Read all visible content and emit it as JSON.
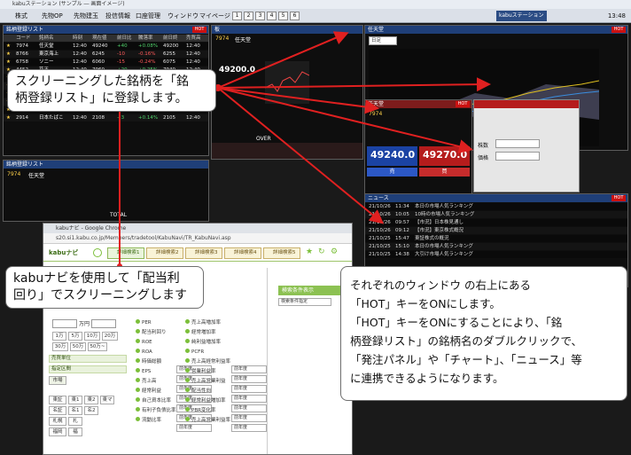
{
  "app": {
    "title": "kabuステーション (サンプル ― 画面イメージ)",
    "menu": [
      "株式",
      "先物OP",
      "先物建玉",
      "投信情報",
      "口座管理",
      "ウィンドウ",
      "マイページ"
    ],
    "layout_numbers": [
      "1",
      "2",
      "3",
      "4",
      "5",
      "6"
    ],
    "logo": "kabuステーション",
    "clock": "13:48",
    "accent_red": "#cc1111",
    "accent_blue": "#1f3f78"
  },
  "list_panel": {
    "title": "銘柄登録リスト",
    "hot_label": "HOT",
    "columns": [
      "コード",
      "銘柄名",
      "時刻",
      "現在値",
      "前日比",
      "騰落率",
      "前日終",
      "売買高"
    ],
    "rows": [
      {
        "code": "7974",
        "name": "任天堂",
        "time": "12:40",
        "price": "49240",
        "chg": "+40",
        "pct": "+0.08%",
        "prev": "49200",
        "vol": "12:40"
      },
      {
        "code": "8766",
        "name": "東京海上",
        "time": "12:40",
        "price": "6245",
        "chg": "-10",
        "pct": "-0.16%",
        "prev": "6255",
        "vol": "12:40"
      },
      {
        "code": "6758",
        "name": "ソニー",
        "time": "12:40",
        "price": "6060",
        "chg": "-15",
        "pct": "-0.24%",
        "prev": "6075",
        "vol": "12:40"
      },
      {
        "code": "4452",
        "name": "花王",
        "time": "12:40",
        "price": "7960",
        "chg": "+20",
        "pct": "+0.25%",
        "prev": "7940",
        "vol": "12:40"
      },
      {
        "code": "3659",
        "name": "ネクソン",
        "time": "12:40",
        "price": "2670",
        "chg": "+5",
        "pct": "+0.19%",
        "prev": "2665",
        "vol": "12:40"
      },
      {
        "code": "4755",
        "name": "ディスコ",
        "time": "12:40",
        "price": "31150",
        "chg": "-150",
        "pct": "-0.48%",
        "prev": "31300",
        "vol": "12:40"
      },
      {
        "code": "4704",
        "name": "トレンド",
        "time": "12:40",
        "price": "6480",
        "chg": "-10",
        "pct": "-0.15%",
        "prev": "6490",
        "vol": "12:40"
      },
      {
        "code": "1925",
        "name": "大和ハウス",
        "time": "12:40",
        "price": "3190",
        "chg": "+15",
        "pct": "+0.47%",
        "prev": "3175",
        "vol": "12:40"
      },
      {
        "code": "4021",
        "name": "日産化",
        "time": "12:40",
        "price": "5960",
        "chg": "+30",
        "pct": "+0.51%",
        "prev": "5930",
        "vol": "12:40"
      },
      {
        "code": "2914",
        "name": "日本たばこ",
        "time": "12:40",
        "price": "2108",
        "chg": "+3",
        "pct": "+0.14%",
        "prev": "2105",
        "vol": "12:40"
      }
    ]
  },
  "board_panel": {
    "title": "板",
    "code": "7974",
    "name": "任天堂",
    "price": "49240.0",
    "sub_price": "49200.0",
    "over": "OVER",
    "under": "UNDER",
    "ask": [
      "49290",
      "49280",
      "49270",
      "49260",
      "49250"
    ],
    "bid": [
      "49240",
      "49230",
      "49220",
      "49210",
      "49200"
    ]
  },
  "chart_panel": {
    "title": "チャート",
    "name": "任天堂",
    "period": "日足",
    "hot_label": "HOT"
  },
  "order_panel": {
    "title": "発注パネル",
    "code": "7974",
    "name": "任天堂",
    "sell_price": "49240.0",
    "buy_price": "49270.0",
    "sell_label": "売",
    "buy_label": "買",
    "hot_label": "HOT",
    "qty_label": "株数",
    "price_label": "価格"
  },
  "news_panel": {
    "title": "ニュース",
    "hot_label": "HOT",
    "items": [
      {
        "date": "21/10/26",
        "time": "11:34",
        "text": "本日の市場人気ランキング"
      },
      {
        "date": "21/10/26",
        "time": "10:05",
        "text": "10時の市場人気ランキング"
      },
      {
        "date": "21/10/26",
        "time": "09:57",
        "text": "【市況】日本株見通し"
      },
      {
        "date": "21/10/26",
        "time": "09:12",
        "text": "【市況】東京株式概況"
      },
      {
        "date": "21/10/25",
        "time": "15:47",
        "text": "東証株式の概況"
      },
      {
        "date": "21/10/25",
        "time": "15:10",
        "text": "本日の市場人気ランキング"
      },
      {
        "date": "21/10/25",
        "time": "14:38",
        "text": "大引け市場人気ランキング"
      }
    ]
  },
  "bottom_left_panel": {
    "title": "銘柄登録リスト",
    "code": "7974",
    "name": "任天堂",
    "total_label": "TOTAL"
  },
  "browser": {
    "title": "kabuナビ - Google Chrome",
    "url": "s20.si1.kabu.co.jp/Members/tradetool/KabuNavi/TR_KabuNavi.asp",
    "brand": "kabuナビ",
    "tabs": [
      "詳細検索1",
      "詳細検索2",
      "詳細検索3",
      "詳細検索4",
      "詳細検索5"
    ],
    "price_unit": "万円",
    "quick_chips": [
      "1万",
      "5万",
      "10万",
      "20万",
      "30万",
      "50万",
      "50万~"
    ],
    "filter_rows": [
      "売買単位",
      "指定区間"
    ],
    "market_cells": [
      "市場",
      "東証",
      "名証",
      "札幌",
      "福岡"
    ],
    "region_cells": [
      "東1",
      "東2",
      "東マ",
      "JQ",
      "名1",
      "名2",
      "札",
      "福"
    ],
    "result_header": "検索条件表示",
    "result_select": "検索条件指定",
    "col_a": [
      "PER",
      "配当利回り",
      "ROE",
      "ROA",
      "時価総額",
      "EPS",
      "売上高",
      "経常利益",
      "自己資本比率",
      "有利子負債比率",
      "流動比率"
    ],
    "col_b": [
      "売上高増加率",
      "経常増加率",
      "純利益増加率",
      "PCFR",
      "売上高経常利益率",
      "営業利益率",
      "売上高営業利益",
      "配当性向",
      "経常利益増加率",
      "PBR変化率",
      "売上高営業利益率"
    ],
    "select_text": "前年度"
  },
  "callouts": {
    "register": [
      "スクリーニングした銘柄を「銘",
      "柄登録リスト」に登録します。"
    ],
    "kabunavi": [
      "kabuナビを使用して「配当利",
      "回り」でスクリーニングします"
    ],
    "hot": [
      "それぞれのウィンドウ の右上にある",
      "「HOT」キーをONにします。",
      "「HOT」キーをONにすることにより、「銘",
      "柄登録リスト」の銘柄名のダブルクリックで、",
      "「発注パネル」や「チャート」、「ニュース」等",
      "に連携できるようになります。"
    ]
  }
}
